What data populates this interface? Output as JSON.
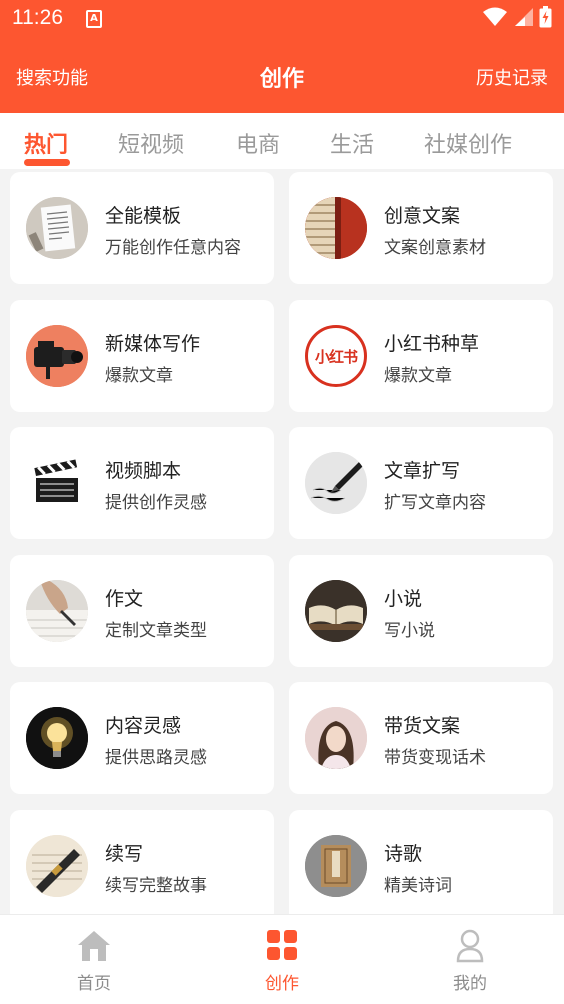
{
  "status_bar": {
    "time": "11:26",
    "sim_label": "A"
  },
  "header": {
    "left_action": "搜索功能",
    "title": "创作",
    "right_action": "历史记录"
  },
  "tabs": [
    {
      "label": "热门",
      "active": true
    },
    {
      "label": "短视频",
      "active": false
    },
    {
      "label": "电商",
      "active": false
    },
    {
      "label": "生活",
      "active": false
    },
    {
      "label": "社媒创作",
      "active": false
    }
  ],
  "cards": [
    {
      "title": "全能模板",
      "subtitle": "万能创作任意内容",
      "icon": "document-template-icon"
    },
    {
      "title": "创意文案",
      "subtitle": "文案创意素材",
      "icon": "books-icon"
    },
    {
      "title": "新媒体写作",
      "subtitle": "爆款文章",
      "icon": "video-camera-icon"
    },
    {
      "title": "小红书种草",
      "subtitle": "爆款文章",
      "icon": "xiaohongshu-logo-icon",
      "logo_text": "小红书"
    },
    {
      "title": "视频脚本",
      "subtitle": "提供创作灵感",
      "icon": "clapperboard-icon"
    },
    {
      "title": "文章扩写",
      "subtitle": "扩写文章内容",
      "icon": "fountain-pen-icon"
    },
    {
      "title": "作文",
      "subtitle": "定制文章类型",
      "icon": "hand-writing-icon"
    },
    {
      "title": "小说",
      "subtitle": "写小说",
      "icon": "open-book-icon"
    },
    {
      "title": "内容灵感",
      "subtitle": "提供思路灵感",
      "icon": "light-bulb-icon"
    },
    {
      "title": "带货文案",
      "subtitle": "带货变现话术",
      "icon": "woman-portrait-icon"
    },
    {
      "title": "续写",
      "subtitle": "续写完整故事",
      "icon": "pen-on-paper-icon"
    },
    {
      "title": "诗歌",
      "subtitle": "精美诗词",
      "icon": "poetry-book-icon"
    }
  ],
  "bottom_nav": [
    {
      "label": "首页",
      "icon": "home-icon",
      "active": false
    },
    {
      "label": "创作",
      "icon": "grid-icon",
      "active": true
    },
    {
      "label": "我的",
      "icon": "user-icon",
      "active": false
    }
  ],
  "colors": {
    "accent": "#fd5630",
    "background": "#f3f3f3",
    "card": "#ffffff"
  }
}
